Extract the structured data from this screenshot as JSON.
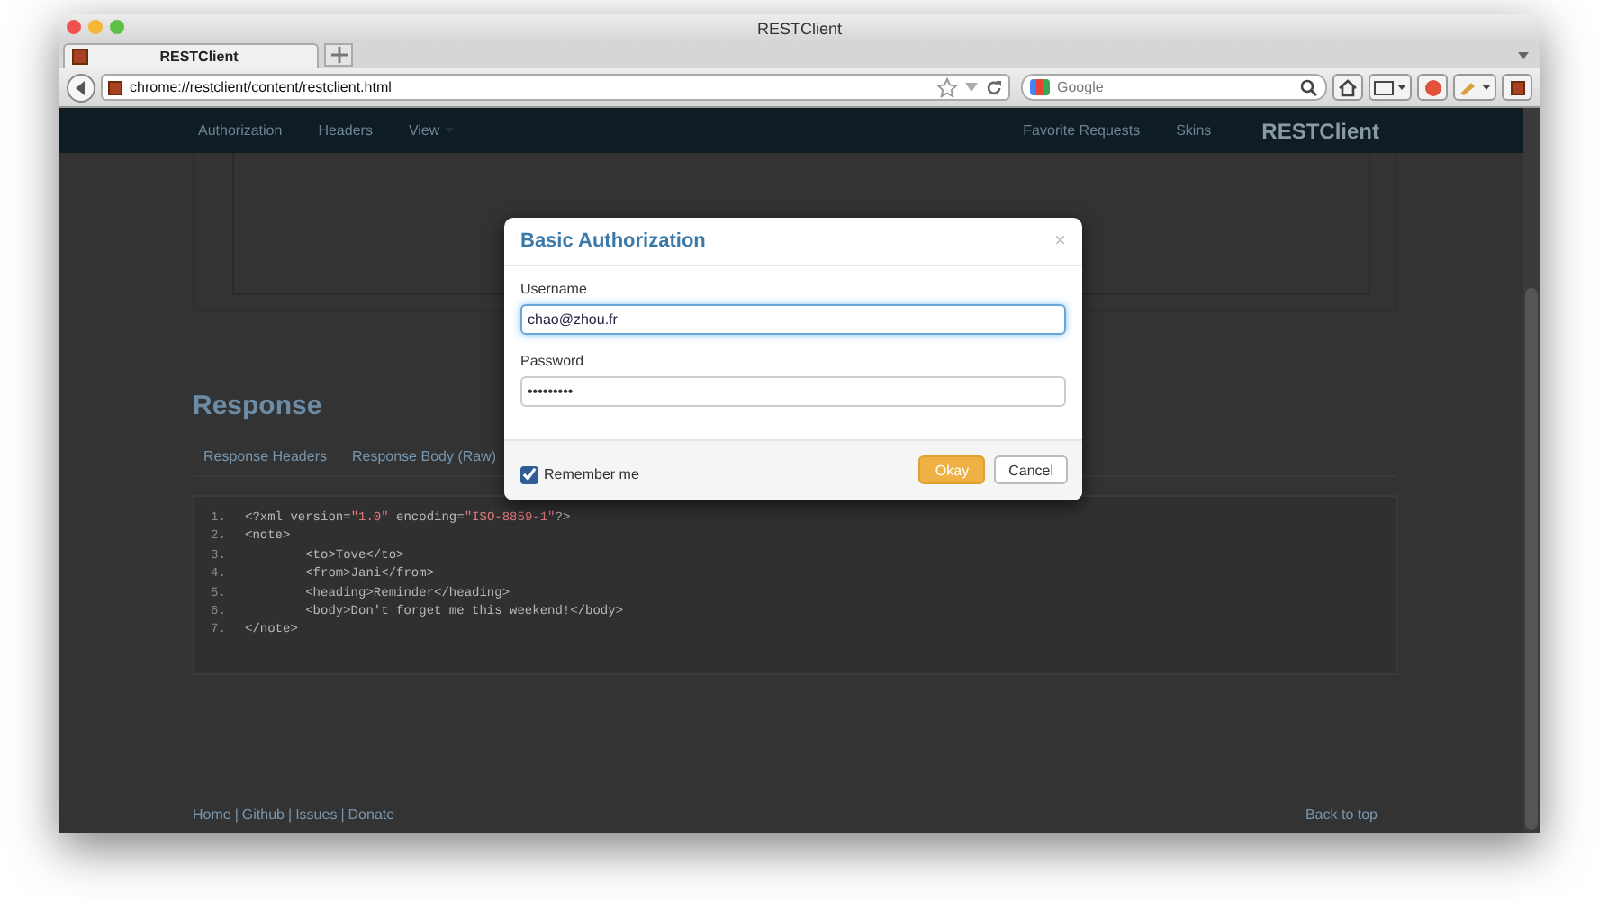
{
  "window": {
    "title": "RESTClient"
  },
  "tabs": [
    {
      "label": "RESTClient",
      "selected": true
    }
  ],
  "address_bar": {
    "url": "chrome://restclient/content/restclient.html"
  },
  "search": {
    "placeholder": "Google"
  },
  "app_nav": {
    "left": [
      "Authorization",
      "Headers",
      "View"
    ],
    "right": [
      "Favorite Requests",
      "Skins"
    ],
    "brand": "RESTClient"
  },
  "response": {
    "heading": "Response",
    "tabs": [
      {
        "label": "Response Headers",
        "selected": false
      },
      {
        "label": "Response Body (Raw)",
        "selected": false
      }
    ],
    "code_lines": [
      {
        "number": "1.",
        "segments": [
          {
            "kind": "plain",
            "text": "<?xml version="
          },
          {
            "kind": "string",
            "text": "\"1.0\""
          },
          {
            "kind": "plain",
            "text": " encoding="
          },
          {
            "kind": "string",
            "text": "\"ISO-8859-1\""
          },
          {
            "kind": "plain",
            "text": "?>"
          }
        ]
      },
      {
        "number": "2.",
        "segments": [
          {
            "kind": "plain",
            "text": "<note>"
          }
        ]
      },
      {
        "number": "3.",
        "segments": [
          {
            "kind": "plain",
            "text": "        <to>Tove</to>"
          }
        ]
      },
      {
        "number": "4.",
        "segments": [
          {
            "kind": "plain",
            "text": "        <from>Jani</from>"
          }
        ]
      },
      {
        "number": "5.",
        "segments": [
          {
            "kind": "plain",
            "text": "        <heading>Reminder</heading>"
          }
        ]
      },
      {
        "number": "6.",
        "segments": [
          {
            "kind": "plain",
            "text": "        <body>Don't forget me this weekend!</body>"
          }
        ]
      },
      {
        "number": "7.",
        "segments": [
          {
            "kind": "plain",
            "text": "</note>"
          }
        ]
      }
    ]
  },
  "footer": {
    "links": [
      "Home",
      "Github",
      "Issues",
      "Donate"
    ],
    "separator": "|",
    "back_to_top": "Back to top"
  },
  "dialog": {
    "title": "Basic Authorization",
    "close": "×",
    "fields": [
      {
        "label": "Username",
        "value": "chao@zhou.fr",
        "focused": true
      },
      {
        "label": "Password",
        "value": "•••••••••",
        "focused": false
      }
    ],
    "remember": {
      "label": "Remember me",
      "checked": true
    },
    "buttons": [
      {
        "label": "Okay",
        "kind": "primary"
      },
      {
        "label": "Cancel",
        "kind": "default"
      }
    ]
  }
}
